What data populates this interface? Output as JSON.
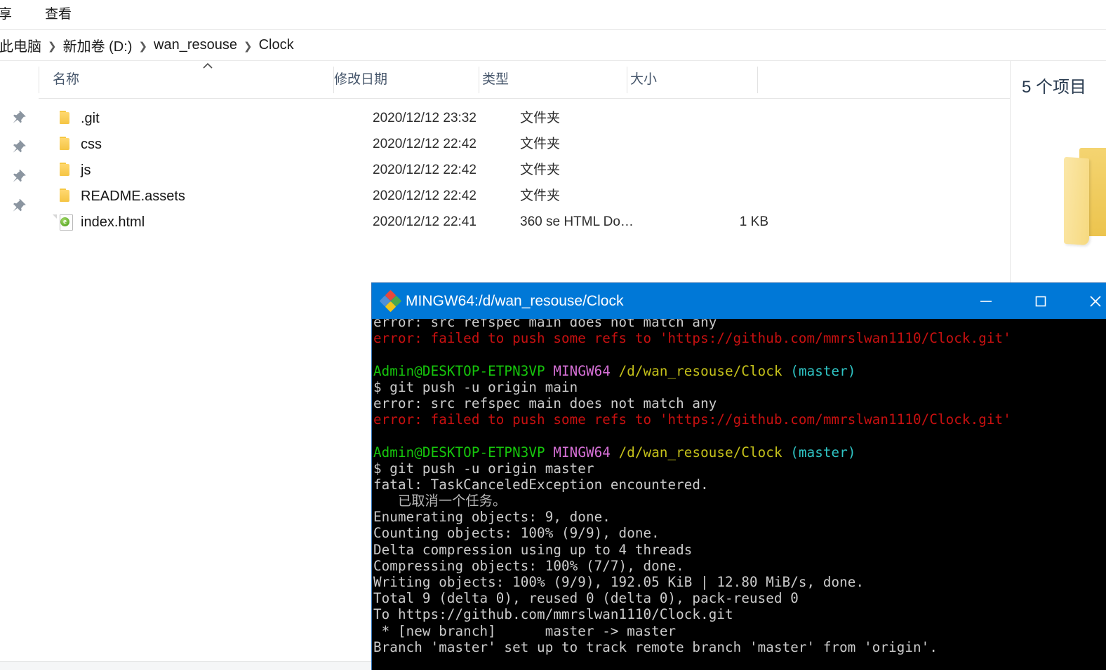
{
  "ribbon": {
    "tabs": [
      {
        "id": "share",
        "label": "享"
      },
      {
        "id": "view",
        "label": "查看"
      }
    ]
  },
  "address_bar": {
    "crumbs": [
      "此电脑",
      "新加卷 (D:)",
      "wan_resouse",
      "Clock"
    ],
    "separator": "❯"
  },
  "nav_pane": {
    "pin_icon": "pin-icon",
    "pin_count": 4
  },
  "file_list": {
    "columns": [
      {
        "id": "name",
        "label": "名称",
        "sorted": "asc",
        "sort_caret": "︿"
      },
      {
        "id": "date",
        "label": "修改日期"
      },
      {
        "id": "type",
        "label": "类型"
      },
      {
        "id": "size",
        "label": "大小"
      }
    ],
    "rows": [
      {
        "icon": "folder-icon",
        "name": ".git",
        "date": "2020/12/12 23:32",
        "type": "文件夹",
        "size": ""
      },
      {
        "icon": "folder-icon",
        "name": "css",
        "date": "2020/12/12 22:42",
        "type": "文件夹",
        "size": ""
      },
      {
        "icon": "folder-icon",
        "name": "js",
        "date": "2020/12/12 22:42",
        "type": "文件夹",
        "size": ""
      },
      {
        "icon": "folder-icon",
        "name": "README.assets",
        "date": "2020/12/12 22:42",
        "type": "文件夹",
        "size": ""
      },
      {
        "icon": "html-doc-icon",
        "name": "index.html",
        "date": "2020/12/12 22:41",
        "type": "360 se HTML Do…",
        "size": "1 KB"
      }
    ]
  },
  "preview_pane": {
    "count_label": "5 个项目",
    "thumbnail": "folder-thumbnail"
  },
  "terminal": {
    "title": "MINGW64:/d/wan_resouse/Clock",
    "title_bar_color": "#0078d7",
    "icon": "mingw64-logo-icon",
    "window_controls": {
      "minimize": "minimize-icon",
      "maximize": "maximize-icon",
      "close": "close-icon"
    },
    "colors": {
      "background": "#000000",
      "foreground": "#cccccc",
      "error_red": "#c81010",
      "user_green": "#16c60c",
      "shell_magenta": "#d670d6",
      "path_yellow": "#c5c11a",
      "branch_cyan": "#2fc4c4"
    },
    "lines": [
      [
        {
          "t": "error: src refspec main does not match any",
          "c": "white"
        }
      ],
      [
        {
          "t": "error: failed to push some refs to 'https://github.com/mmrslwan1110/Clock.git'",
          "c": "red"
        }
      ],
      [
        {
          "t": "",
          "c": "white"
        }
      ],
      [
        {
          "t": "Admin@DESKTOP-ETPN3VP",
          "c": "green"
        },
        {
          "t": " ",
          "c": "white"
        },
        {
          "t": "MINGW64",
          "c": "magenta"
        },
        {
          "t": " ",
          "c": "white"
        },
        {
          "t": "/d/wan_resouse/Clock",
          "c": "yellow"
        },
        {
          "t": " ",
          "c": "white"
        },
        {
          "t": "(master)",
          "c": "cyan"
        }
      ],
      [
        {
          "t": "$ git push -u origin main",
          "c": "white"
        }
      ],
      [
        {
          "t": "error: src refspec main does not match any",
          "c": "white"
        }
      ],
      [
        {
          "t": "error: failed to push some refs to 'https://github.com/mmrslwan1110/Clock.git'",
          "c": "red"
        }
      ],
      [
        {
          "t": "",
          "c": "white"
        }
      ],
      [
        {
          "t": "Admin@DESKTOP-ETPN3VP",
          "c": "green"
        },
        {
          "t": " ",
          "c": "white"
        },
        {
          "t": "MINGW64",
          "c": "magenta"
        },
        {
          "t": " ",
          "c": "white"
        },
        {
          "t": "/d/wan_resouse/Clock",
          "c": "yellow"
        },
        {
          "t": " ",
          "c": "white"
        },
        {
          "t": "(master)",
          "c": "cyan"
        }
      ],
      [
        {
          "t": "$ git push -u origin master",
          "c": "white"
        }
      ],
      [
        {
          "t": "fatal: TaskCanceledException encountered.",
          "c": "white"
        }
      ],
      [
        {
          "t": "   已取消一个任务。",
          "c": "grey"
        }
      ],
      [
        {
          "t": "Enumerating objects: 9, done.",
          "c": "white"
        }
      ],
      [
        {
          "t": "Counting objects: 100% (9/9), done.",
          "c": "white"
        }
      ],
      [
        {
          "t": "Delta compression using up to 4 threads",
          "c": "white"
        }
      ],
      [
        {
          "t": "Compressing objects: 100% (7/7), done.",
          "c": "white"
        }
      ],
      [
        {
          "t": "Writing objects: 100% (9/9), 192.05 KiB | 12.80 MiB/s, done.",
          "c": "white"
        }
      ],
      [
        {
          "t": "Total 9 (delta 0), reused 0 (delta 0), pack-reused 0",
          "c": "white"
        }
      ],
      [
        {
          "t": "To https://github.com/mmrslwan1110/Clock.git",
          "c": "white"
        }
      ],
      [
        {
          "t": " * [new branch]      master -> master",
          "c": "white"
        }
      ],
      [
        {
          "t": "Branch 'master' set up to track remote branch 'master' from 'origin'.",
          "c": "white"
        }
      ]
    ]
  }
}
